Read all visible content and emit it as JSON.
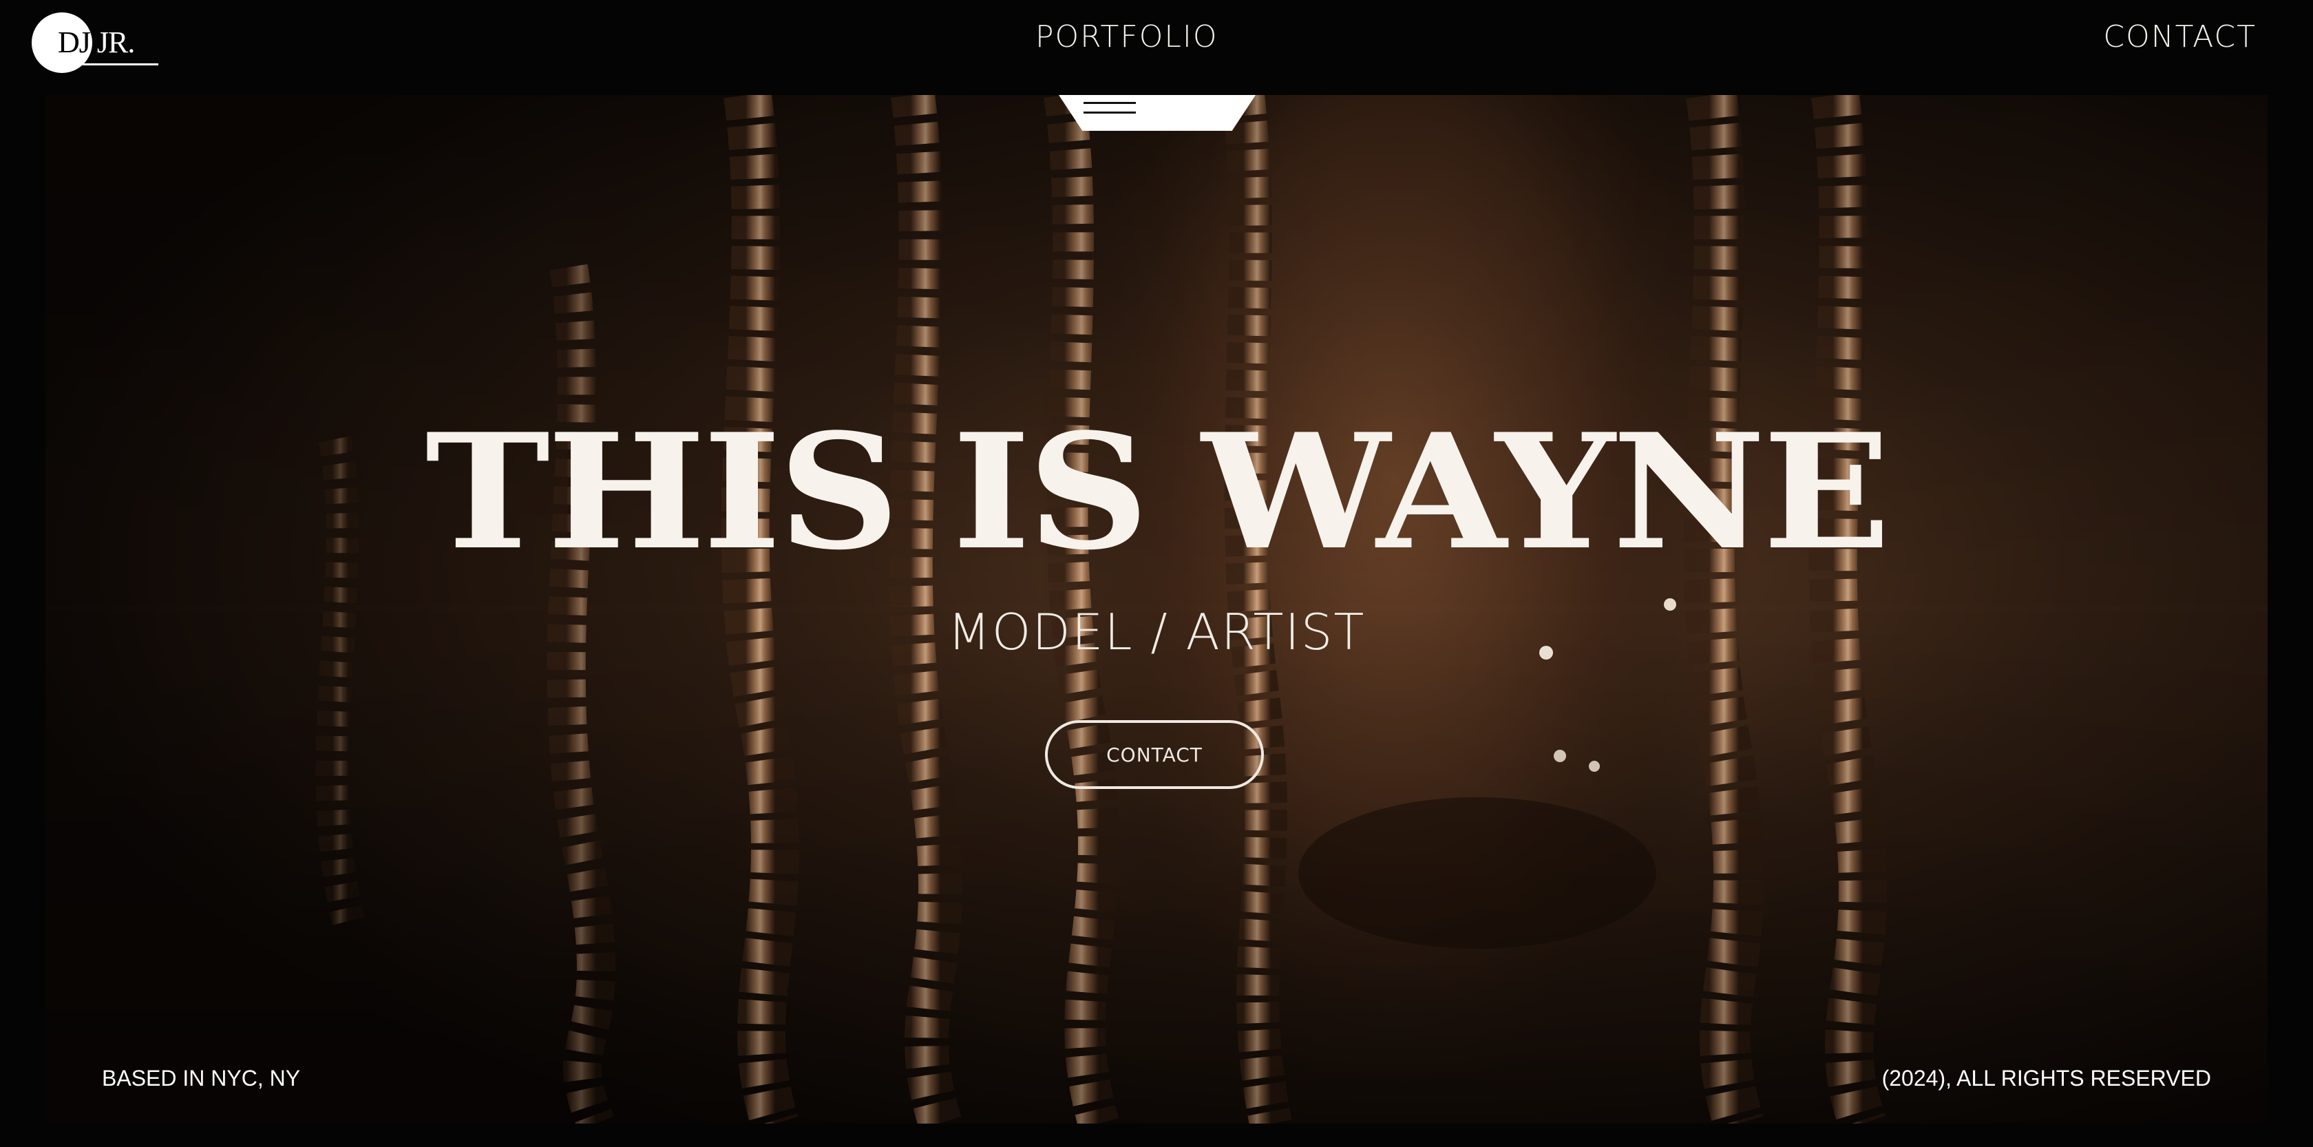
{
  "header": {
    "logo_text": "DJ JR.",
    "nav": {
      "portfolio_label": "PORTFOLIO",
      "contact_label": "CONTACT"
    }
  },
  "hero": {
    "menu_icon": "hamburger-menu-icon",
    "title": "THIS IS WAYNE",
    "subtitle": "MODEL / ARTIST",
    "cta_label": "CONTACT",
    "background_image": "portrait photo of person with curly braids in warm sepia tones"
  },
  "footer": {
    "location": "BASED IN NYC, NY",
    "copyright": "(2024), ALL RIGHTS RESERVED"
  },
  "colors": {
    "page_background": "#040404",
    "text": "#f5f2ec",
    "hero_tone": "#8a5a34"
  }
}
